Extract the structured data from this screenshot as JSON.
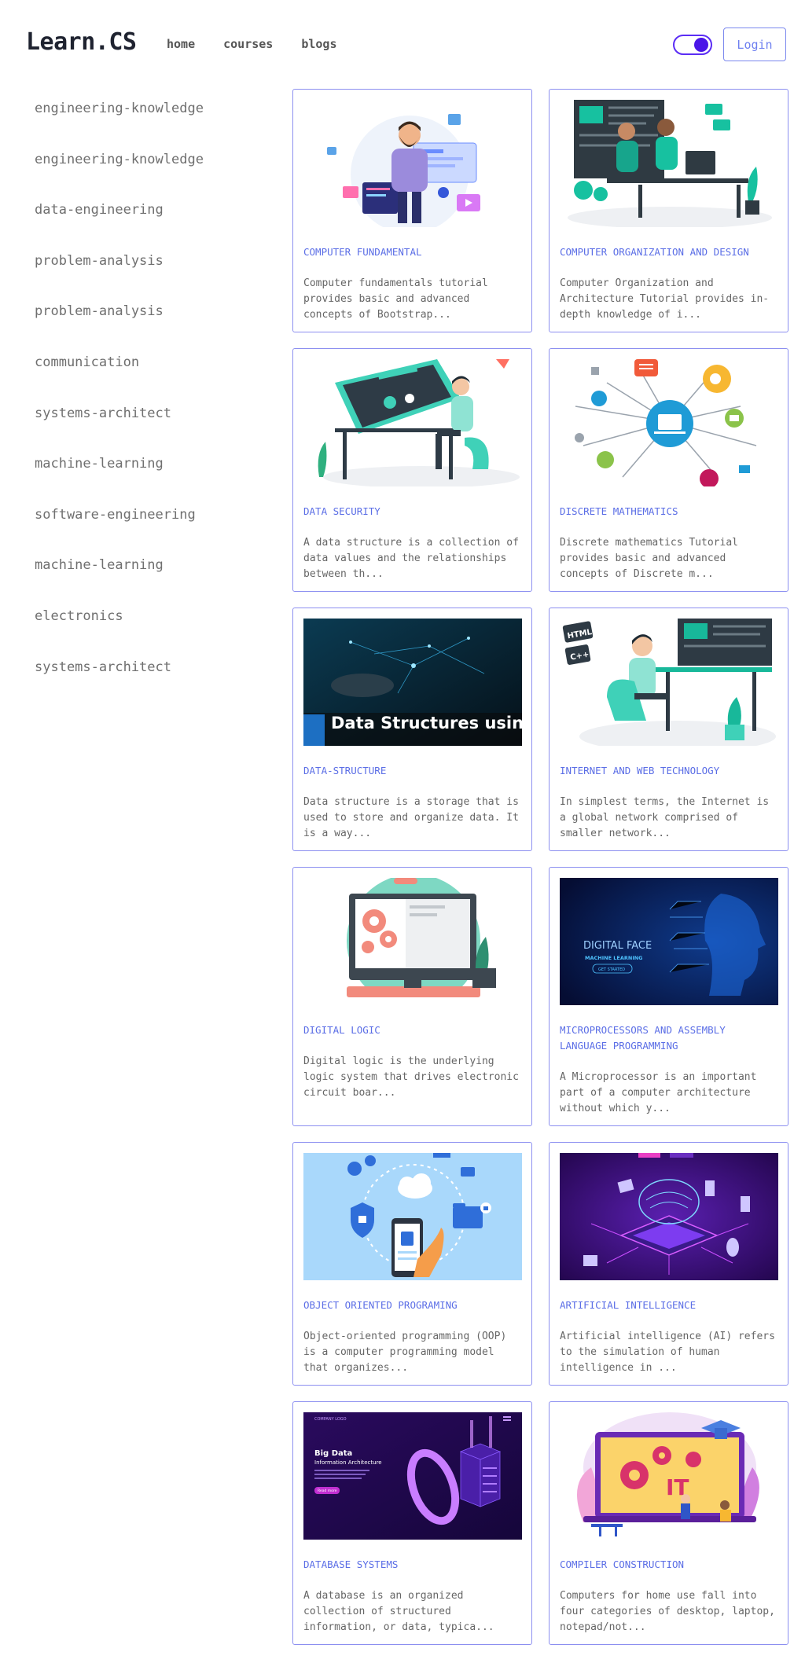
{
  "header": {
    "logo": "Learn.CS",
    "nav": [
      "home",
      "courses",
      "blogs"
    ],
    "login_label": "Login",
    "theme_toggle": "on"
  },
  "sidebar": {
    "items": [
      "engineering-knowledge",
      "engineering-knowledge",
      "data-engineering",
      "problem-analysis",
      "problem-analysis",
      "communication",
      "systems-architect",
      "machine-learning",
      "software-engineering",
      "machine-learning",
      "electronics",
      "systems-architect"
    ]
  },
  "cards": [
    {
      "title": "COMPUTER FUNDAMENTAL",
      "desc": "Computer fundamentals tutorial provides basic and advanced concepts of Bootstrap...",
      "image": "developer-illustration"
    },
    {
      "title": "COMPUTER ORGANIZATION AND DESIGN",
      "desc": "Computer Organization and Architecture Tutorial provides in-depth knowledge of i...",
      "image": "team-workstation-illustration"
    },
    {
      "title": "DATA SECURITY",
      "desc": "A data structure is a collection of data values and the relationships between th...",
      "image": "interaction-design-illustration"
    },
    {
      "title": "DISCRETE MATHEMATICS",
      "desc": "Discrete mathematics Tutorial provides basic and advanced concepts of Discrete m...",
      "image": "circuit-icons-illustration"
    },
    {
      "title": "DATA-STRUCTURE",
      "desc": "Data structure is a storage that is used to store and organize data. It is a way...",
      "image": "data-structures-banner",
      "image_text": "Data Structures using C"
    },
    {
      "title": "INTERNET AND WEB TECHNOLOGY",
      "desc": "In simplest terms, the Internet is a global network comprised of smaller network...",
      "image": "coder-desk-illustration",
      "image_labels": [
        "HTML",
        "C++"
      ]
    },
    {
      "title": "DIGITAL LOGIC",
      "desc": "Digital logic is the underlying logic system that drives electronic circuit boar...",
      "image": "monitor-gears-illustration"
    },
    {
      "title": "MICROPROCESSORS AND ASSEMBLY LANGUAGE PROGRAMMING",
      "desc": "A Microprocessor is an important part of a computer architecture without which y...",
      "image": "digital-face-banner",
      "image_text": [
        "DIGITAL FACE",
        "MACHINE LEARNING",
        "GET STARTED"
      ]
    },
    {
      "title": "OBJECT ORIENTED PROGRAMING",
      "desc": "Object-oriented programming (OOP) is a computer programming model that organizes...",
      "image": "cloud-security-illustration"
    },
    {
      "title": "ARTIFICIAL INTELLIGENCE",
      "desc": "Artificial intelligence (AI) refers to the simulation of human intelligence in ...",
      "image": "ai-chip-illustration"
    },
    {
      "title": "DATABASE SYSTEMS",
      "desc": "A database is an organized collection of structured information, or data, typica...",
      "image": "big-data-banner",
      "image_text": [
        "COMPANY LOGO",
        "Big Data",
        "Information Architecture",
        "Read more"
      ]
    },
    {
      "title": "COMPILER CONSTRUCTION",
      "desc": "Computers for home use fall into four categories of desktop, laptop, notepad/not...",
      "image": "it-laptop-illustration",
      "image_text": "IT"
    }
  ]
}
